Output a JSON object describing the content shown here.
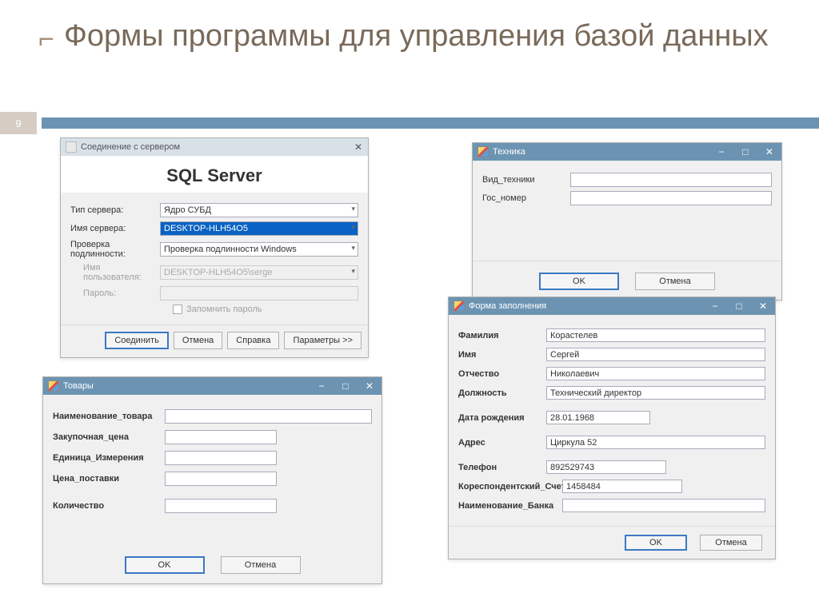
{
  "slide": {
    "title": "Формы программы для управления базой данных",
    "page": "9"
  },
  "sql": {
    "title": "Соединение с сервером",
    "heading": "SQL Server",
    "labels": {
      "type": "Тип сервера:",
      "name": "Имя сервера:",
      "auth": "Проверка подлинности:",
      "user": "Имя пользователя:",
      "pass": "Пароль:",
      "remember": "Запомнить пароль"
    },
    "values": {
      "type": "Ядро СУБД",
      "name": "DESKTOP-HLH54O5",
      "auth": "Проверка подлинности Windows",
      "user": "DESKTOP-HLH54O5\\serge",
      "pass": ""
    },
    "buttons": {
      "connect": "Соединить",
      "cancel": "Отмена",
      "help": "Справка",
      "params": "Параметры >>"
    }
  },
  "tech": {
    "title": "Техника",
    "labels": {
      "vid": "Вид_техники",
      "gos": "Гос_номер"
    },
    "buttons": {
      "ok": "OK",
      "cancel": "Отмена"
    }
  },
  "goods": {
    "title": "Товары",
    "labels": {
      "name": "Наименование_товара",
      "price": "Закупочная_цена",
      "unit": "Единица_Измерения",
      "supply": "Цена_поставки",
      "qty": "Количество"
    },
    "buttons": {
      "ok": "OK",
      "cancel": "Отмена"
    }
  },
  "form": {
    "title": "Форма заполнения",
    "labels": {
      "lname": "Фамилия",
      "fname": "Имя",
      "mname": "Отчество",
      "pos": "Должность",
      "dob": "Дата рождения",
      "addr": "Адрес",
      "tel": "Телефон",
      "acct": "Кореспондентский_Счет",
      "bank": "Наименование_Банка"
    },
    "values": {
      "lname": "Корастелев",
      "fname": "Сергей",
      "mname": "Николаевич",
      "pos": "Технический директор",
      "dob": "28.01.1968",
      "addr": "Циркула 52",
      "tel": "892529743",
      "acct": "1458484",
      "bank": ""
    },
    "buttons": {
      "ok": "OK",
      "cancel": "Отмена"
    }
  }
}
